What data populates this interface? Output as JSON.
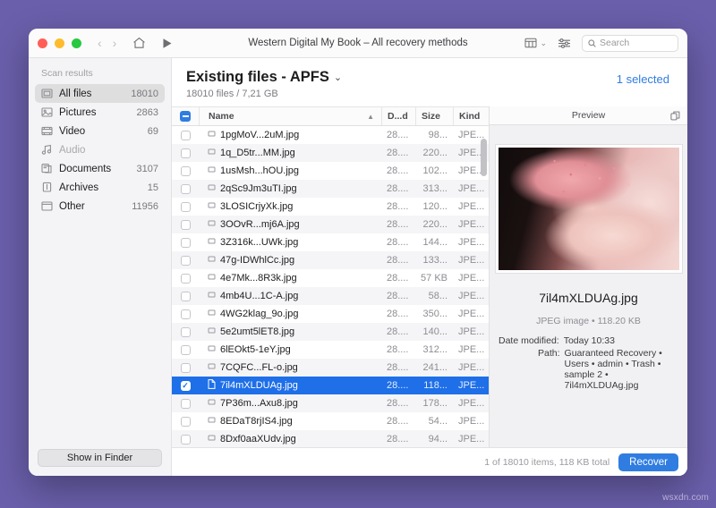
{
  "desktop": {
    "background": "#6a5fab",
    "watermark": "wsxdn.com"
  },
  "window": {
    "title": "Western Digital My Book – All recovery methods",
    "traffic": {
      "close": "close-button",
      "minimize": "minimize-button",
      "zoom": "zoom-button"
    },
    "nav": {
      "back": "‹",
      "forward": "›"
    },
    "icons": {
      "home": "home-icon",
      "play": "play-icon",
      "view_mode": "view-mode-icon",
      "filter": "filter-icon",
      "search": "search-icon"
    },
    "search": {
      "placeholder": "Search",
      "value": ""
    }
  },
  "sidebar": {
    "header": "Scan results",
    "items": [
      {
        "label": "All files",
        "count": "18010",
        "icon": "all-files-icon",
        "active": true
      },
      {
        "label": "Pictures",
        "count": "2863",
        "icon": "pictures-icon",
        "active": false
      },
      {
        "label": "Video",
        "count": "69",
        "icon": "video-icon",
        "active": false
      },
      {
        "label": "Audio",
        "count": "",
        "icon": "audio-icon",
        "active": false,
        "dim": true
      },
      {
        "label": "Documents",
        "count": "3107",
        "icon": "documents-icon",
        "active": false
      },
      {
        "label": "Archives",
        "count": "15",
        "icon": "archives-icon",
        "active": false
      },
      {
        "label": "Other",
        "count": "11956",
        "icon": "other-icon",
        "active": false
      }
    ],
    "show_in_finder": "Show in Finder"
  },
  "main": {
    "title": "Existing files - APFS",
    "title_chevron": "⌄",
    "subtitle": "18010 files / 7,21 GB",
    "selected_label": "1 selected",
    "selected_color": "#2f7de1"
  },
  "table": {
    "columns": {
      "name": "Name",
      "date": "D...d",
      "size": "Size",
      "kind": "Kind"
    },
    "sort_arrow": "▲",
    "rows": [
      {
        "name": "1pgMoV...2uM.jpg",
        "date": "28....",
        "size": "98...",
        "kind": "JPE...",
        "checked": false,
        "selected": false
      },
      {
        "name": "1q_D5tr...MM.jpg",
        "date": "28....",
        "size": "220...",
        "kind": "JPE...",
        "checked": false,
        "selected": false
      },
      {
        "name": "1usMsh...hOU.jpg",
        "date": "28....",
        "size": "102...",
        "kind": "JPE...",
        "checked": false,
        "selected": false
      },
      {
        "name": "2qSc9Jm3uTI.jpg",
        "date": "28....",
        "size": "313...",
        "kind": "JPE...",
        "checked": false,
        "selected": false
      },
      {
        "name": "3LOSICrjyXk.jpg",
        "date": "28....",
        "size": "120...",
        "kind": "JPE...",
        "checked": false,
        "selected": false
      },
      {
        "name": "3OOvR...mj6A.jpg",
        "date": "28....",
        "size": "220...",
        "kind": "JPE...",
        "checked": false,
        "selected": false
      },
      {
        "name": "3Z316k...UWk.jpg",
        "date": "28....",
        "size": "144...",
        "kind": "JPE...",
        "checked": false,
        "selected": false
      },
      {
        "name": "47g-IDWhlCc.jpg",
        "date": "28....",
        "size": "133...",
        "kind": "JPE...",
        "checked": false,
        "selected": false
      },
      {
        "name": "4e7Mk...8R3k.jpg",
        "date": "28....",
        "size": "57 KB",
        "kind": "JPE...",
        "checked": false,
        "selected": false
      },
      {
        "name": "4mb4U...1C-A.jpg",
        "date": "28....",
        "size": "58...",
        "kind": "JPE...",
        "checked": false,
        "selected": false
      },
      {
        "name": "4WG2klag_9o.jpg",
        "date": "28....",
        "size": "350...",
        "kind": "JPE...",
        "checked": false,
        "selected": false
      },
      {
        "name": "5e2umt5lET8.jpg",
        "date": "28....",
        "size": "140...",
        "kind": "JPE...",
        "checked": false,
        "selected": false
      },
      {
        "name": "6lEOkt5-1eY.jpg",
        "date": "28....",
        "size": "312...",
        "kind": "JPE...",
        "checked": false,
        "selected": false
      },
      {
        "name": "7CQFC...FL-o.jpg",
        "date": "28....",
        "size": "241...",
        "kind": "JPE...",
        "checked": false,
        "selected": false
      },
      {
        "name": "7il4mXLDUAg.jpg",
        "date": "28....",
        "size": "118...",
        "kind": "JPE...",
        "checked": true,
        "selected": true
      },
      {
        "name": "7P36m...Axu8.jpg",
        "date": "28....",
        "size": "178...",
        "kind": "JPE...",
        "checked": false,
        "selected": false
      },
      {
        "name": "8EDaT8rjIS4.jpg",
        "date": "28....",
        "size": "54...",
        "kind": "JPE...",
        "checked": false,
        "selected": false
      },
      {
        "name": "8Dxf0aaXUdv.jpg",
        "date": "28....",
        "size": "94...",
        "kind": "JPE...",
        "checked": false,
        "selected": false
      }
    ]
  },
  "preview": {
    "header": "Preview",
    "expand_icon": "expand-icon",
    "image_alt": "person holding pink babys breath flowers",
    "filename": "7il4mXLDUAg.jpg",
    "kind_size": "JPEG image • 118.20 KB",
    "date_label": "Date modified:",
    "date_value": "Today 10:33",
    "path_label": "Path:",
    "path_value": "Guaranteed Recovery • Users • admin • Trash • sample 2 • 7il4mXLDUAg.jpg"
  },
  "bottom": {
    "status": "1 of 18010 items, 118 KB total",
    "recover_label": "Recover"
  }
}
